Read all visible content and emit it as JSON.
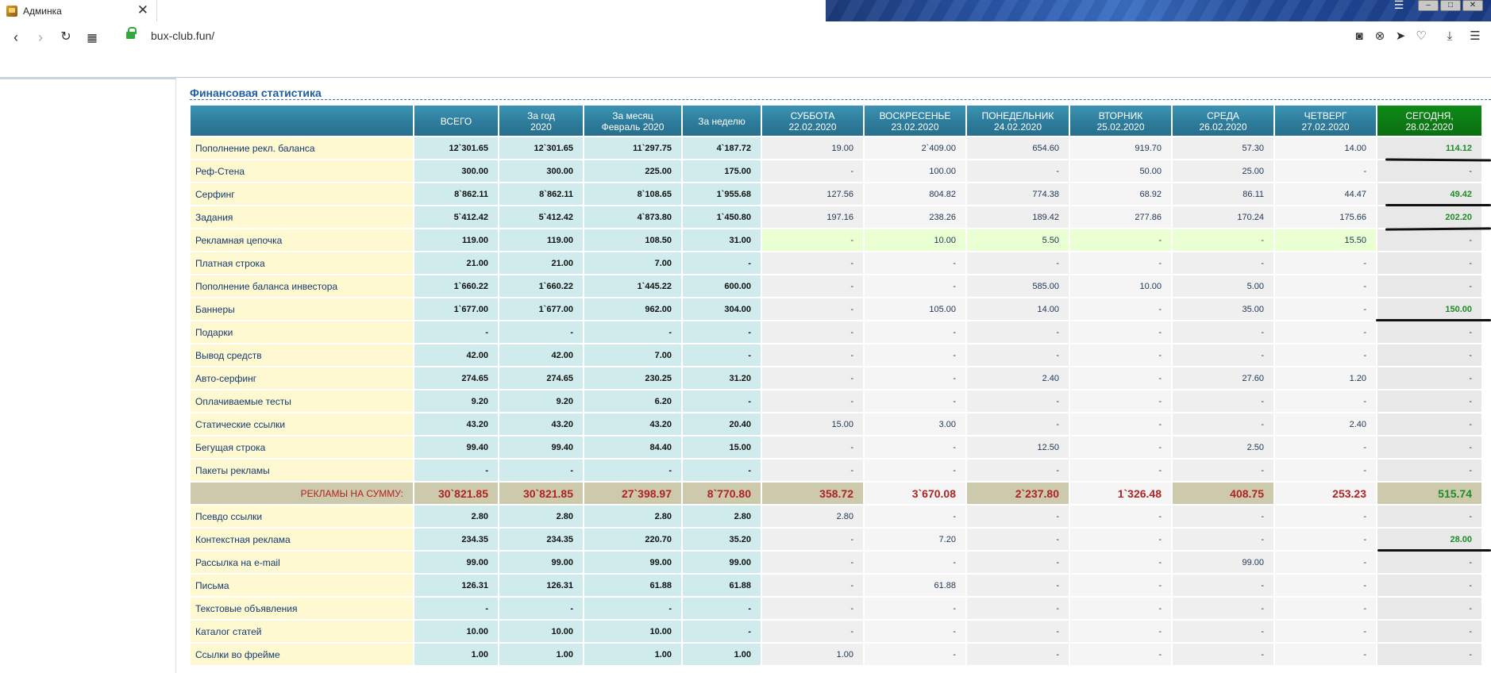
{
  "browser": {
    "tab_title": "Админка",
    "address": "bux-club.fun/"
  },
  "page": {
    "section_title": "Финансовая статистика"
  },
  "table": {
    "columns": [
      {
        "line1": "",
        "line2": "",
        "line3": ""
      },
      {
        "line1": "ВСЕГО",
        "line2": "",
        "line3": ""
      },
      {
        "line1": "За год",
        "line2": "2020",
        "line3": ""
      },
      {
        "line1": "За месяц",
        "line2": "Февраль 2020",
        "line3": ""
      },
      {
        "line1": "За неделю",
        "line2": "",
        "line3": ""
      },
      {
        "line1": "СУББОТА",
        "line2": "22.02.2020",
        "line3": ""
      },
      {
        "line1": "ВОСКРЕСЕНЬЕ",
        "line2": "23.02.2020",
        "line3": ""
      },
      {
        "line1": "ПОНЕДЕЛЬНИК",
        "line2": "24.02.2020",
        "line3": ""
      },
      {
        "line1": "ВТОРНИК",
        "line2": "25.02.2020",
        "line3": ""
      },
      {
        "line1": "СРЕДА",
        "line2": "26.02.2020",
        "line3": ""
      },
      {
        "line1": "ЧЕТВЕРГ",
        "line2": "27.02.2020",
        "line3": ""
      },
      {
        "line1": "СЕГОДНЯ,",
        "line2": "28.02.2020",
        "line3": ""
      }
    ],
    "rows": [
      {
        "label": "Пополнение рекл. баланса",
        "values": [
          "12`301.65",
          "12`301.65",
          "11`297.75",
          "4`187.72",
          "19.00",
          "2`409.00",
          "654.60",
          "919.70",
          "57.30",
          "14.00",
          "114.12"
        ]
      },
      {
        "label": "Реф-Стена",
        "values": [
          "300.00",
          "300.00",
          "225.00",
          "175.00",
          "-",
          "100.00",
          "-",
          "50.00",
          "25.00",
          "-",
          "-"
        ]
      },
      {
        "label": "Серфинг",
        "values": [
          "8`862.11",
          "8`862.11",
          "8`108.65",
          "1`955.68",
          "127.56",
          "804.82",
          "774.38",
          "68.92",
          "86.11",
          "44.47",
          "49.42"
        ]
      },
      {
        "label": "Задания",
        "values": [
          "5`412.42",
          "5`412.42",
          "4`873.80",
          "1`450.80",
          "197.16",
          "238.26",
          "189.42",
          "277.86",
          "170.24",
          "175.66",
          "202.20"
        ]
      },
      {
        "label": "Рекламная цепочка",
        "values": [
          "119.00",
          "119.00",
          "108.50",
          "31.00",
          "-",
          "10.00",
          "5.50",
          "-",
          "-",
          "15.50",
          "-"
        ]
      },
      {
        "label": "Платная строка",
        "values": [
          "21.00",
          "21.00",
          "7.00",
          "-",
          "-",
          "-",
          "-",
          "-",
          "-",
          "-",
          "-"
        ]
      },
      {
        "label": "Пополнение баланса инвестора",
        "values": [
          "1`660.22",
          "1`660.22",
          "1`445.22",
          "600.00",
          "-",
          "-",
          "585.00",
          "10.00",
          "5.00",
          "-",
          "-"
        ]
      },
      {
        "label": "Баннеры",
        "values": [
          "1`677.00",
          "1`677.00",
          "962.00",
          "304.00",
          "-",
          "105.00",
          "14.00",
          "-",
          "35.00",
          "-",
          "150.00"
        ]
      },
      {
        "label": "Подарки",
        "values": [
          "-",
          "-",
          "-",
          "-",
          "-",
          "-",
          "-",
          "-",
          "-",
          "-",
          "-"
        ]
      },
      {
        "label": "Вывод средств",
        "values": [
          "42.00",
          "42.00",
          "7.00",
          "-",
          "-",
          "-",
          "-",
          "-",
          "-",
          "-",
          "-"
        ]
      },
      {
        "label": "Авто-серфинг",
        "values": [
          "274.65",
          "274.65",
          "230.25",
          "31.20",
          "-",
          "-",
          "2.40",
          "-",
          "27.60",
          "1.20",
          "-"
        ]
      },
      {
        "label": "Оплачиваемые тесты",
        "values": [
          "9.20",
          "9.20",
          "6.20",
          "-",
          "-",
          "-",
          "-",
          "-",
          "-",
          "-",
          "-"
        ]
      },
      {
        "label": "Статические ссылки",
        "values": [
          "43.20",
          "43.20",
          "43.20",
          "20.40",
          "15.00",
          "3.00",
          "-",
          "-",
          "-",
          "2.40",
          "-"
        ]
      },
      {
        "label": "Бегущая строка",
        "values": [
          "99.40",
          "99.40",
          "84.40",
          "15.00",
          "-",
          "-",
          "12.50",
          "-",
          "2.50",
          "-",
          "-"
        ]
      },
      {
        "label": "Пакеты рекламы",
        "values": [
          "-",
          "-",
          "-",
          "-",
          "-",
          "-",
          "-",
          "-",
          "-",
          "-",
          "-"
        ]
      },
      {
        "label": "РЕКЛАМЫ НА СУММУ:",
        "values": [
          "30`821.85",
          "30`821.85",
          "27`398.97",
          "8`770.80",
          "358.72",
          "3`670.08",
          "2`237.80",
          "1`326.48",
          "408.75",
          "253.23",
          "515.74"
        ]
      },
      {
        "label": "Псевдо ссылки",
        "values": [
          "2.80",
          "2.80",
          "2.80",
          "2.80",
          "2.80",
          "-",
          "-",
          "-",
          "-",
          "-",
          "-"
        ]
      },
      {
        "label": "Контекстная реклама",
        "values": [
          "234.35",
          "234.35",
          "220.70",
          "35.20",
          "-",
          "7.20",
          "-",
          "-",
          "-",
          "-",
          "28.00"
        ]
      },
      {
        "label": "Рассылка на e-mail",
        "values": [
          "99.00",
          "99.00",
          "99.00",
          "99.00",
          "-",
          "-",
          "-",
          "-",
          "99.00",
          "-",
          "-"
        ]
      },
      {
        "label": "Письма",
        "values": [
          "126.31",
          "126.31",
          "61.88",
          "61.88",
          "-",
          "61.88",
          "-",
          "-",
          "-",
          "-",
          "-"
        ]
      },
      {
        "label": "Текстовые объявления",
        "values": [
          "-",
          "-",
          "-",
          "-",
          "-",
          "-",
          "-",
          "-",
          "-",
          "-",
          "-"
        ]
      },
      {
        "label": "Каталог статей",
        "values": [
          "10.00",
          "10.00",
          "10.00",
          "-",
          "-",
          "-",
          "-",
          "-",
          "-",
          "-",
          "-"
        ]
      },
      {
        "label": "Ссылки во фрейме",
        "values": [
          "1.00",
          "1.00",
          "1.00",
          "1.00",
          "1.00",
          "-",
          "-",
          "-",
          "-",
          "-",
          "-"
        ]
      }
    ]
  },
  "colors": {
    "header_blue": "#2e7c9c",
    "today_green": "#0a6e12",
    "label_yellow": "#fff9d2",
    "aggregate_cyan": "#cfebeb",
    "total_row": "#cdc9ad",
    "total_text": "#b02323",
    "positive_today": "#1e8c27"
  },
  "icons": {
    "back": "chevron-left-icon",
    "forward": "chevron-right-icon",
    "reload": "reload-icon",
    "grid": "grid-icon",
    "lock": "lock-icon",
    "camera": "camera-icon",
    "block": "block-icon",
    "send": "send-icon",
    "heart": "heart-icon",
    "download": "download-icon",
    "menu": "menu-icon"
  }
}
